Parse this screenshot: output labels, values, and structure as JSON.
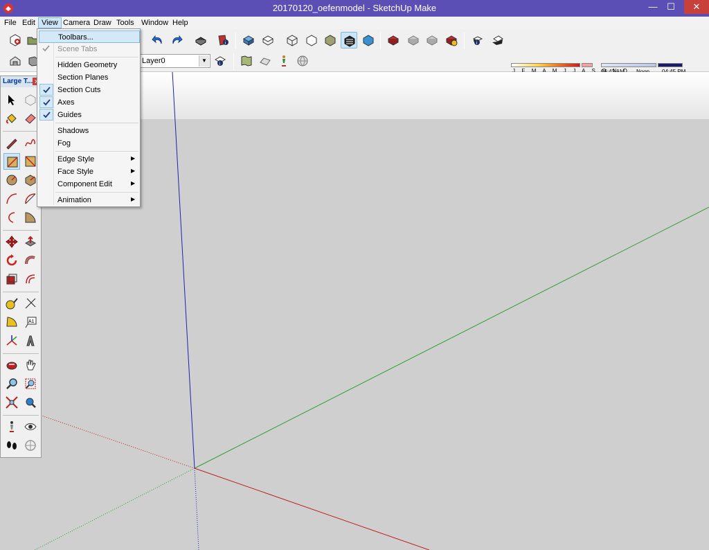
{
  "window": {
    "title": "20170120_oefenmodel - SketchUp Make",
    "minimize": "—",
    "maximize": "☐",
    "close": "✕"
  },
  "menubar": {
    "items": [
      "File",
      "Edit",
      "View",
      "Camera",
      "Draw",
      "Tools",
      "Window",
      "Help"
    ],
    "active": "View"
  },
  "view_menu": {
    "toolbars": "Toolbars...",
    "scene_tabs": "Scene Tabs",
    "hidden_geometry": "Hidden Geometry",
    "section_planes": "Section Planes",
    "section_cuts": "Section Cuts",
    "axes": "Axes",
    "guides": "Guides",
    "shadows": "Shadows",
    "fog": "Fog",
    "edge_style": "Edge Style",
    "face_style": "Face Style",
    "component_edit": "Component Edit",
    "animation": "Animation",
    "submenu_arrow": "▶",
    "checked": [
      "Scene Tabs",
      "Section Cuts",
      "Axes",
      "Guides"
    ]
  },
  "layers": {
    "current": "Layer0",
    "dropdown_arrow": "▼"
  },
  "shadow_settings": {
    "months": "J F M A M J J A S O N D",
    "time_start": "06:43 AM",
    "time_noon": "Noon",
    "time_end": "04:45 PM"
  },
  "tool_panel": {
    "title": "Large T...",
    "close": "x"
  },
  "colors": {
    "titlebar": "#5b4fb6",
    "red_axis": "#c02020",
    "green_axis": "#2fa02f",
    "blue_axis": "#2020b0",
    "highlight": "#cde6f7"
  }
}
